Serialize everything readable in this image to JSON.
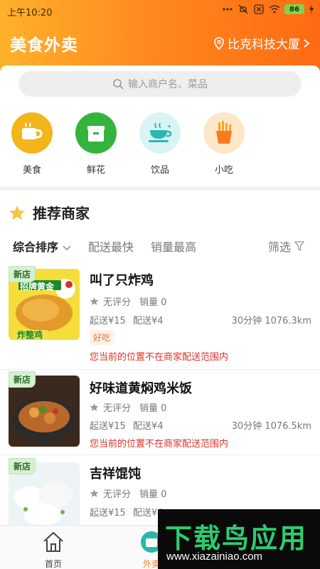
{
  "status_bar": {
    "time": "上午10:20",
    "battery": "86"
  },
  "header": {
    "title": "美食外卖",
    "location": "比克科技大厦"
  },
  "search": {
    "placeholder": "输入商户名、菜品"
  },
  "categories": [
    {
      "label": "美食",
      "icon": "coffee-cup-icon",
      "color": "#f2b51c"
    },
    {
      "label": "鲜花",
      "icon": "gift-box-icon",
      "color": "#34b43d"
    },
    {
      "label": "饮品",
      "icon": "teacup-icon",
      "color": "#d9f4f3"
    },
    {
      "label": "小吃",
      "icon": "fries-icon",
      "color": "#fde7c7"
    }
  ],
  "recommend": {
    "title": "推荐商家",
    "sort": {
      "comprehensive": "综合排序",
      "fastest": "配送最快",
      "top_sales": "销量最高",
      "filter": "筛选"
    },
    "shops": [
      {
        "badge": "新店",
        "name": "叫了只炸鸡",
        "rating": "无评分",
        "sales": "销量 0",
        "min_order": "起送¥15",
        "delivery_fee": "配送¥4",
        "eta_distance": "30分钟 1076.3km",
        "tag": "好吃",
        "warning": "您当前的位置不在商家配送范围内",
        "thumb_text_top": "招牌黄金",
        "thumb_text_bottom": "炸整鸡"
      },
      {
        "badge": "新店",
        "name": "好味道黄焖鸡米饭",
        "rating": "无评分",
        "sales": "销量 0",
        "min_order": "起送¥15",
        "delivery_fee": "配送¥4",
        "eta_distance": "30分钟 1076.5km",
        "warning": "您当前的位置不在商家配送范围内"
      },
      {
        "badge": "新店",
        "name": "吉祥馄饨",
        "rating": "无评分",
        "sales": "销量 0",
        "min_order": "起送¥15",
        "delivery_fee": "配送¥4"
      }
    ]
  },
  "bottom_nav": {
    "home": "首页",
    "takeout": "外卖"
  },
  "watermark": {
    "brand": "下载鸟应用",
    "url": "www.xiazainiao.com"
  },
  "colors": {
    "accent": "#ff7a18",
    "warning": "#d8332a"
  }
}
